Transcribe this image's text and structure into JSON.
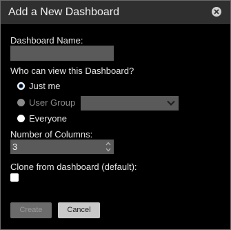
{
  "dialog": {
    "title": "Add a New Dashboard"
  },
  "form": {
    "name_label": "Dashboard Name:",
    "name_value": "",
    "visibility_label": "Who can view this Dashboard?",
    "visibility_options": [
      {
        "label": "Just me",
        "checked": true,
        "disabled": false
      },
      {
        "label": "User Group",
        "checked": false,
        "disabled": true
      },
      {
        "label": "Everyone",
        "checked": false,
        "disabled": false
      }
    ],
    "user_group_selected": "",
    "columns_label": "Number of Columns:",
    "columns_value": "3",
    "clone_label": "Clone from dashboard (default):",
    "clone_checked": false
  },
  "buttons": {
    "create_label": "Create",
    "cancel_label": "Cancel"
  },
  "icons": {
    "close": "close-icon",
    "dropdown": "chevron-down-icon",
    "stepper_up": "caret-up-icon",
    "stepper_down": "caret-down-icon"
  },
  "colors": {
    "background": "#000000",
    "titlebar": "#2f2f2f",
    "field": "#5a5a5a",
    "text": "#e6e6e6",
    "disabled_text": "#8a8a8a",
    "radio_accent": "#1d5fb0"
  }
}
